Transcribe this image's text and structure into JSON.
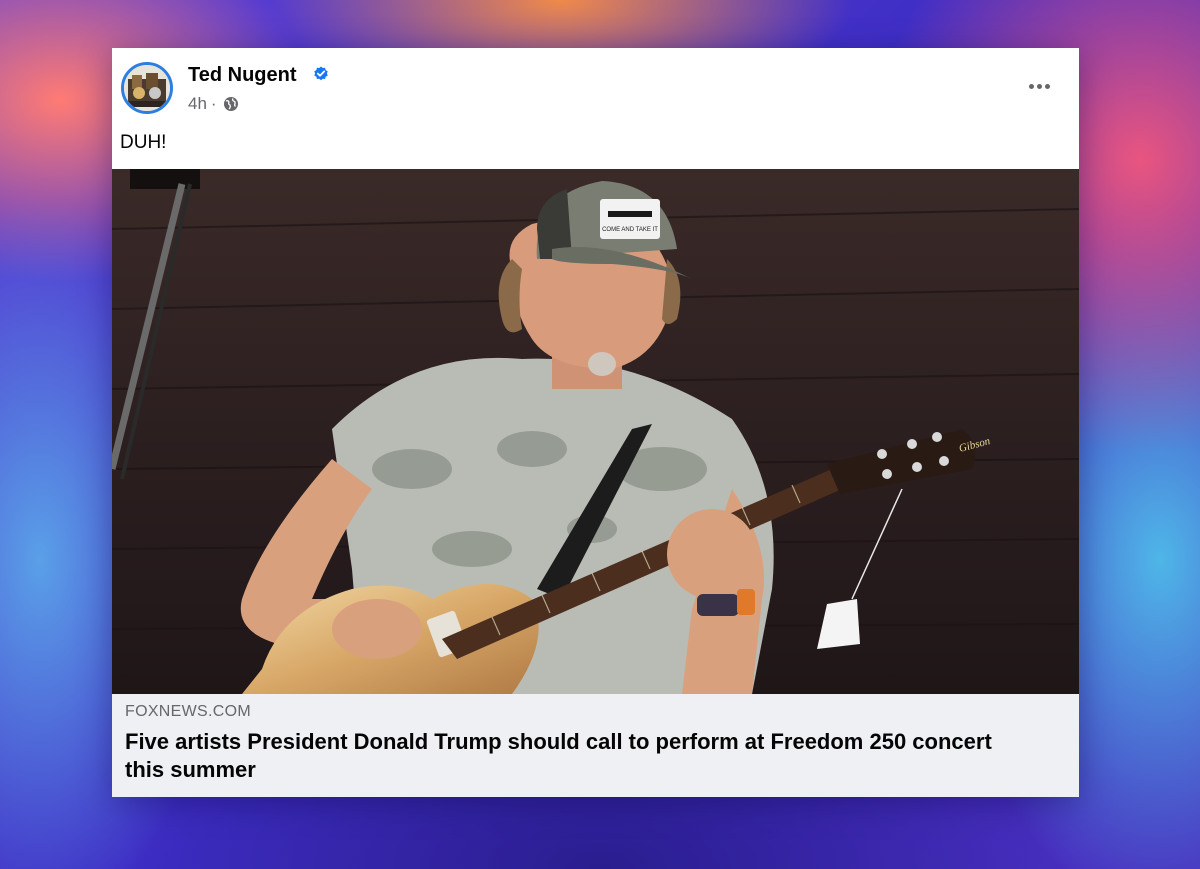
{
  "post": {
    "author": "Ted Nugent",
    "verified": true,
    "time": "4h",
    "separator": "·",
    "audience_icon": "globe-icon",
    "more_icon": "more-options-icon",
    "text": "DUH!"
  },
  "link_preview": {
    "domain": "FOXNEWS.COM",
    "headline": "Five artists President Donald Trump should call to perform at Freedom 250 concert this summer"
  },
  "photo": {
    "description_icon": "photo-guitarist",
    "cap_patch_text": "COME AND TAKE IT",
    "guitar_brand": "Gibson"
  },
  "colors": {
    "verified_badge": "#1877f2",
    "secondary_text": "#65676b",
    "link_box_bg": "#eef0f3"
  }
}
